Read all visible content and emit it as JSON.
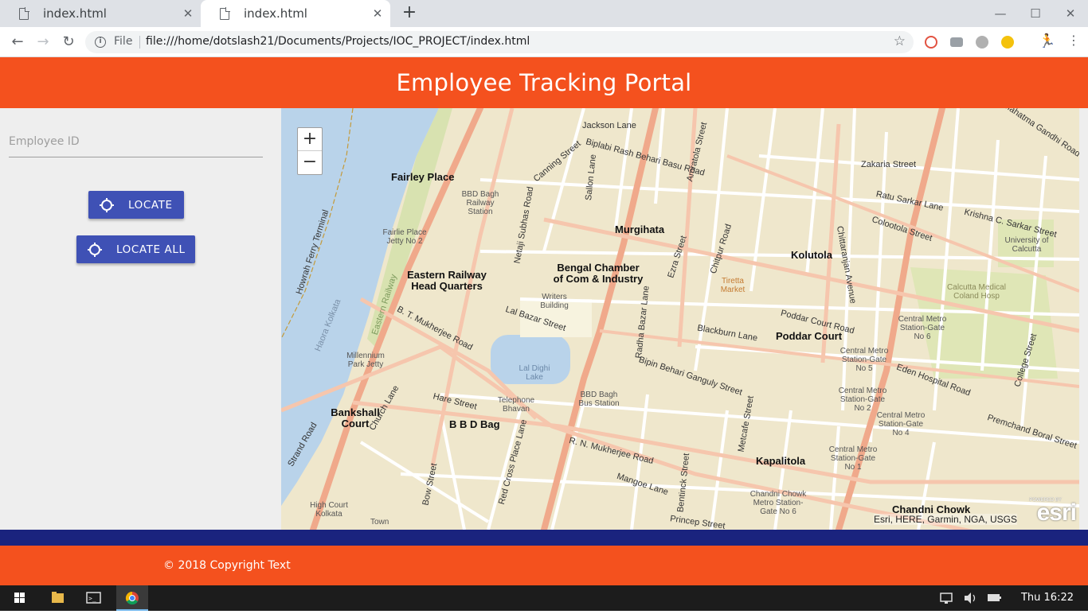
{
  "browser": {
    "tabs": [
      {
        "title": "index.html",
        "close": "✕"
      },
      {
        "title": "index.html",
        "close": "✕"
      }
    ],
    "new_tab": "+",
    "window_controls": {
      "minimize": "—",
      "maximize": "☐",
      "close": "✕"
    },
    "nav": {
      "back": "←",
      "forward": "→",
      "reload": "↻"
    },
    "address": {
      "scheme_label": "File",
      "url": "file:///home/dotslash21/Documents/Projects/IOC_PROJECT/index.html"
    },
    "icons": [
      "info-icon",
      "star-icon",
      "extension-icon",
      "profile-icon"
    ]
  },
  "header": {
    "title": "Employee Tracking Portal"
  },
  "sidebar": {
    "employee_id_placeholder": "Employee ID",
    "locate_label": "LOCATE",
    "locate_all_label": "LOCATE ALL"
  },
  "map": {
    "zoom_in": "+",
    "zoom_out": "−",
    "attribution": "Esri, HERE, Garmin, NGA, USGS",
    "logo": "esri",
    "logo_caption": "POWERED BY",
    "places": [
      "Fairley Place",
      "Murgihata",
      "Kolutola",
      "Eastern Railway Head Quarters",
      "Bengal Chamber of Com & Industry",
      "Poddar Court",
      "Bankshall Court",
      "B B D Bag",
      "Kapalitola",
      "Chandni Chowk"
    ],
    "small_labels": [
      "BBD Bagh Railway Station",
      "Fairlie Place Jetty No 2",
      "Writers Building",
      "Lal Dighi Lake",
      "Millennium Park Jetty",
      "Telephone Bhavan",
      "BBD Bagh Bus Station",
      "Tiretta Market",
      "University of Calcutta",
      "Calcutta Medical Coland Hosp",
      "Central Metro Station-Gate No 6",
      "Central Metro Station-Gate No 5",
      "Central Metro Station-Gate No 2",
      "Central Metro Station-Gate No 4",
      "Central Metro Station-Gate No 1",
      "Chandni Chowk Metro Station-Gate No 6",
      "High Court Kolkata",
      "Town"
    ],
    "streets": [
      "Jackson Lane",
      "Biplabi Rash Behari Basu Road",
      "Zakaria Street",
      "Ratu Sarkar Lane",
      "Colootola Street",
      "Canning Street",
      "Lal Bazar Street",
      "Blackburn Lane",
      "Poddar Court Road",
      "Eden Hospital Road",
      "Bipin Behari Ganguly Street",
      "Hare Street",
      "R. N. Mukherjee Road",
      "Mangoe Lane",
      "Premchand Boral Street",
      "Ezra Street",
      "Chitpur Road",
      "Chittaranjan Avenue",
      "College Street",
      "Howrah Ferry Terminal",
      "Haora Kolkata",
      "Eastern Railway",
      "Netaji Subhas Road",
      "B. T. Mukherjee Road",
      "Strand Road",
      "Church Lane",
      "Metcafe Street",
      "Bentinck Street",
      "Red Cross Place Lane",
      "Radha Bazar Lane",
      "Princep Street",
      "Mahatma Gandhi Road",
      "Krishna C. Sarkar Street",
      "Sallon Lane",
      "Amratola Street",
      "Bow Street"
    ]
  },
  "footer": {
    "copyright": "© 2018 Copyright Text"
  },
  "taskbar": {
    "icons": [
      "windows-start-icon",
      "file-explorer-icon",
      "terminal-icon",
      "chrome-icon"
    ],
    "tray_icons": [
      "network-icon",
      "volume-icon",
      "battery-icon"
    ],
    "clock": "Thu 16:22"
  },
  "colors": {
    "header_bg": "#f4511e",
    "button_bg": "#3f51b5",
    "strip_bg": "#1a237e",
    "map_land": "#efe7cc",
    "map_water": "#b9d3ea",
    "map_major_road": "#f0a98b"
  }
}
